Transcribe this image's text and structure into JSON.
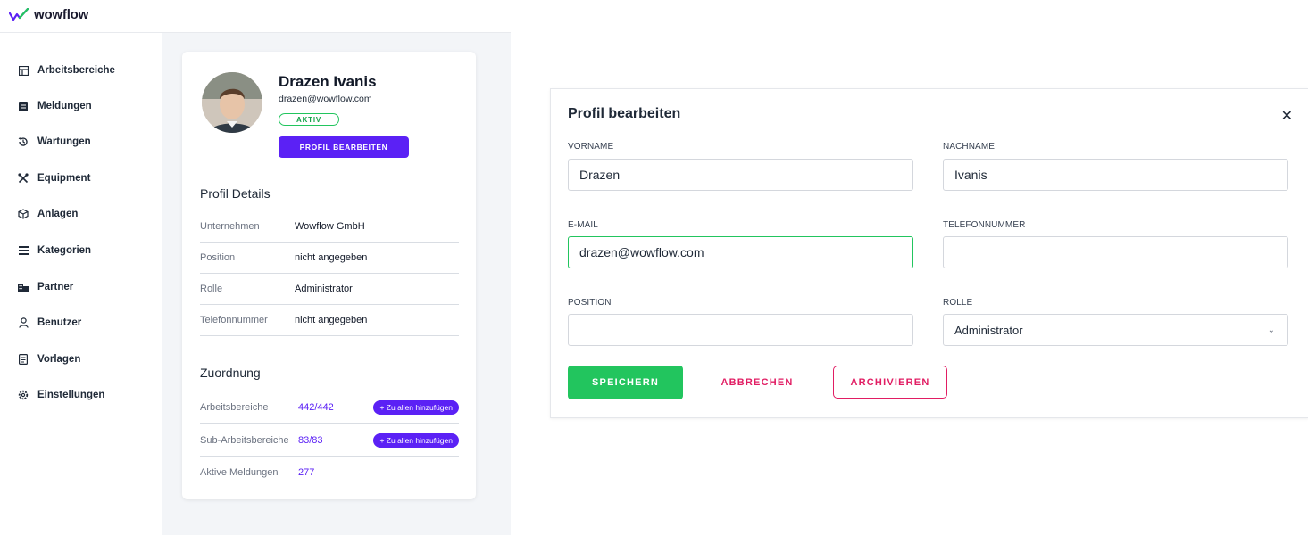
{
  "app": {
    "brand": "wowflow"
  },
  "sidebar": {
    "items": [
      {
        "label": "Arbeitsbereiche",
        "icon": "layout-icon"
      },
      {
        "label": "Meldungen",
        "icon": "message-icon"
      },
      {
        "label": "Wartungen",
        "icon": "history-icon"
      },
      {
        "label": "Equipment",
        "icon": "tools-icon"
      },
      {
        "label": "Anlagen",
        "icon": "cube-icon"
      },
      {
        "label": "Kategorien",
        "icon": "list-icon"
      },
      {
        "label": "Partner",
        "icon": "building-icon"
      },
      {
        "label": "Benutzer",
        "icon": "user-icon"
      },
      {
        "label": "Vorlagen",
        "icon": "document-icon"
      },
      {
        "label": "Einstellungen",
        "icon": "gear-icon"
      }
    ]
  },
  "profile": {
    "name": "Drazen Ivanis",
    "email": "drazen@wowflow.com",
    "status": "AKTIV",
    "edit_button": "PROFIL BEARBEITEN",
    "details_title": "Profil Details",
    "details": [
      {
        "label": "Unternehmen",
        "value": "Wowflow GmbH"
      },
      {
        "label": "Position",
        "value": "nicht angegeben"
      },
      {
        "label": "Rolle",
        "value": "Administrator"
      },
      {
        "label": "Telefonnummer",
        "value": "nicht angegeben"
      }
    ],
    "assignment_title": "Zuordnung",
    "assignments": [
      {
        "label": "Arbeitsbereiche",
        "value": "442/442",
        "action": "+ Zu allen hinzufügen"
      },
      {
        "label": "Sub-Arbeitsbereiche",
        "value": "83/83",
        "action": "+ Zu allen hinzufügen"
      },
      {
        "label": "Aktive Meldungen",
        "value": "277"
      }
    ]
  },
  "modal": {
    "title": "Profil bearbeiten",
    "close": "✕",
    "fields": {
      "firstname": {
        "label": "VORNAME",
        "value": "Drazen"
      },
      "lastname": {
        "label": "NACHNAME",
        "value": "Ivanis"
      },
      "email": {
        "label": "E-MAIL",
        "value": "drazen@wowflow.com"
      },
      "phone": {
        "label": "TELEFONNUMMER",
        "value": ""
      },
      "position": {
        "label": "POSITION",
        "value": ""
      },
      "role": {
        "label": "ROLLE",
        "value": "Administrator"
      }
    },
    "save": "SPEICHERN",
    "cancel": "ABBRECHEN",
    "archive": "ARCHIVIEREN"
  },
  "colors": {
    "primary": "#5b21f5",
    "success": "#22c55e",
    "danger": "#e11d63"
  }
}
